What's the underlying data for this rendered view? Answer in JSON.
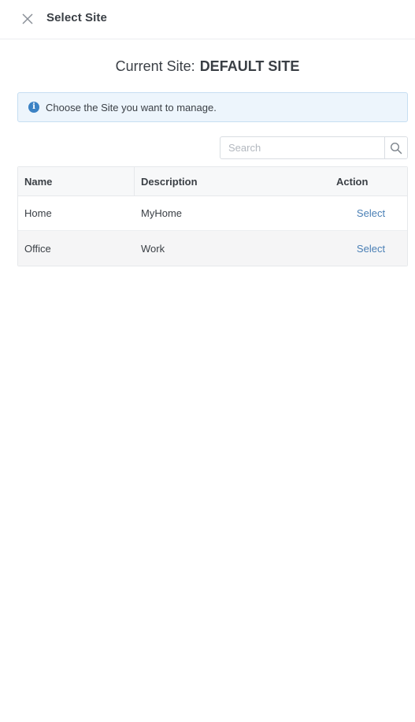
{
  "header": {
    "title": "Select Site",
    "close_icon": "close-icon"
  },
  "current_site": {
    "label": "Current Site:",
    "value": "DEFAULT SITE"
  },
  "info_banner": {
    "icon": "info-icon",
    "text": "Choose the Site you want to manage.",
    "accent_color": "#3b82c4"
  },
  "search": {
    "placeholder": "Search",
    "value": "",
    "icon": "search-icon"
  },
  "table": {
    "columns": [
      "Name",
      "Description",
      "Action"
    ],
    "rows": [
      {
        "name": "Home",
        "description": "MyHome",
        "action": "Select"
      },
      {
        "name": "Office",
        "description": "Work",
        "action": "Select"
      }
    ]
  },
  "colors": {
    "link": "#4a7fb5",
    "banner_bg": "#edf5fc",
    "text": "#3a3f45"
  }
}
